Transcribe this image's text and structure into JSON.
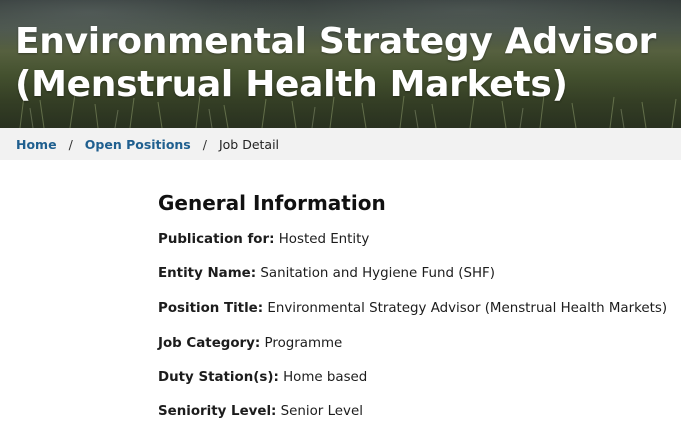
{
  "hero": {
    "title_line1": "Environmental Strategy Advisor",
    "title_line2": "(Menstrual Health Markets)"
  },
  "breadcrumb": {
    "home": "Home",
    "open_positions": "Open Positions",
    "separator": "/",
    "current": "Job Detail"
  },
  "general_info": {
    "heading": "General Information",
    "fields": [
      {
        "label": "Publication for:",
        "value": "Hosted Entity"
      },
      {
        "label": "Entity Name:",
        "value": "Sanitation and Hygiene Fund (SHF)"
      },
      {
        "label": "Position Title:",
        "value": "Environmental Strategy Advisor (Menstrual Health Markets)"
      },
      {
        "label": "Job Category:",
        "value": "Programme"
      },
      {
        "label": "Duty Station(s):",
        "value": "Home based"
      },
      {
        "label": "Seniority Level:",
        "value": "Senior Level"
      }
    ]
  },
  "colors": {
    "link": "#1f5f8f",
    "breadcrumb_bg": "#f2f2f2"
  }
}
